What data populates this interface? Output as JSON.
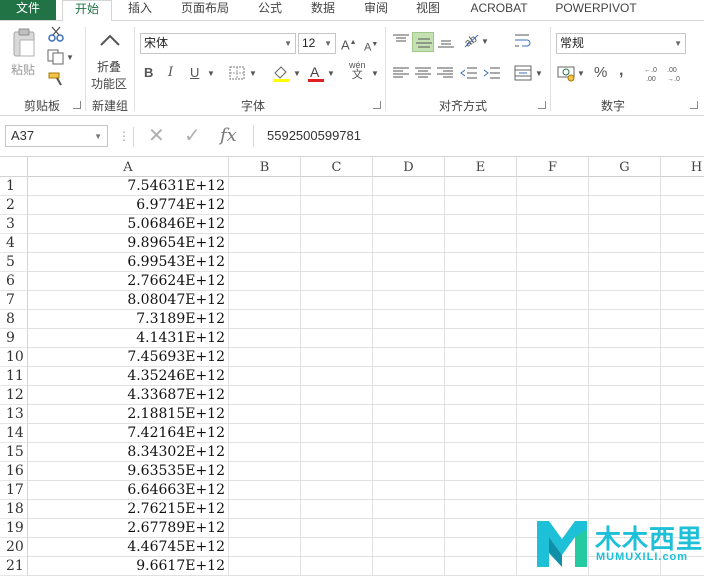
{
  "menu": {
    "tabs": [
      {
        "label": "文件"
      },
      {
        "label": "开始"
      },
      {
        "label": "插入"
      },
      {
        "label": "页面布局"
      },
      {
        "label": "公式"
      },
      {
        "label": "数据"
      },
      {
        "label": "审阅"
      },
      {
        "label": "视图"
      },
      {
        "label": "ACROBAT"
      },
      {
        "label": "POWERPIVOT"
      }
    ],
    "active_tab": "开始"
  },
  "ribbon": {
    "clipboard": {
      "paste_label": "粘贴",
      "group_label": "剪贴板"
    },
    "new_group": {
      "fold_label_1": "折叠",
      "fold_label_2": "功能区",
      "group_label": "新建组"
    },
    "font": {
      "font_name": "宋体",
      "font_size": "12",
      "bold": "B",
      "italic": "I",
      "underline": "U",
      "phonetic": "wén",
      "group_label": "字体"
    },
    "alignment": {
      "group_label": "对齐方式"
    },
    "number": {
      "format": "常规",
      "percent": "%",
      "comma": ",",
      "group_label": "数字"
    }
  },
  "formula_bar": {
    "name_box": "A37",
    "fx": "fx",
    "value": "5592500599781"
  },
  "columns": [
    "A",
    "B",
    "C",
    "D",
    "E",
    "F",
    "G",
    "H"
  ],
  "rows": [
    {
      "num": "1",
      "a": "7.54631E+12"
    },
    {
      "num": "2",
      "a": "6.9774E+12"
    },
    {
      "num": "3",
      "a": "5.06846E+12"
    },
    {
      "num": "4",
      "a": "9.89654E+12"
    },
    {
      "num": "5",
      "a": "6.99543E+12"
    },
    {
      "num": "6",
      "a": "2.76624E+12"
    },
    {
      "num": "7",
      "a": "8.08047E+12"
    },
    {
      "num": "8",
      "a": "7.3189E+12"
    },
    {
      "num": "9",
      "a": "4.1431E+12"
    },
    {
      "num": "10",
      "a": "7.45693E+12"
    },
    {
      "num": "11",
      "a": "4.35246E+12"
    },
    {
      "num": "12",
      "a": "4.33687E+12"
    },
    {
      "num": "13",
      "a": "2.18815E+12"
    },
    {
      "num": "14",
      "a": "7.42164E+12"
    },
    {
      "num": "15",
      "a": "8.34302E+12"
    },
    {
      "num": "16",
      "a": "9.63535E+12"
    },
    {
      "num": "17",
      "a": "6.64663E+12"
    },
    {
      "num": "18",
      "a": "2.76215E+12"
    },
    {
      "num": "19",
      "a": "2.67789E+12"
    },
    {
      "num": "20",
      "a": "4.46745E+12"
    },
    {
      "num": "21",
      "a": "9.6617E+12"
    }
  ],
  "watermark": {
    "text": "木木西里",
    "sub": "MUMUXILI.com"
  },
  "colors": {
    "excel_green": "#217346",
    "active_fill": "#c5e0b3",
    "watermark": "#1ec0d8"
  }
}
